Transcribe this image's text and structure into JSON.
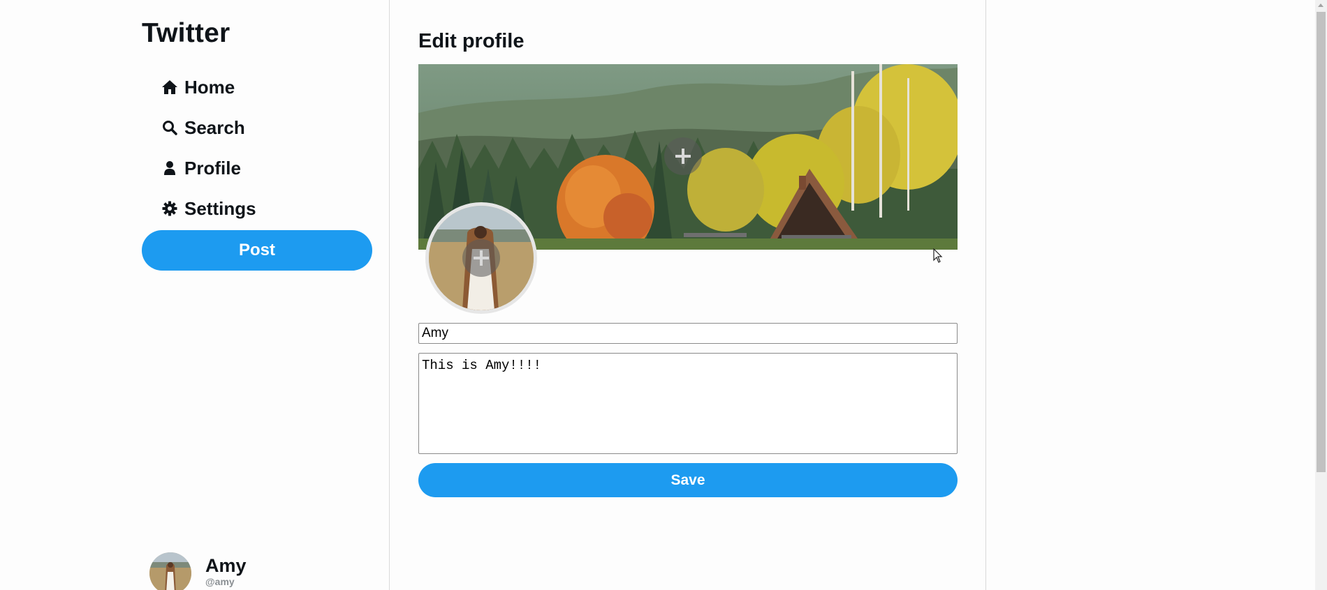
{
  "app": {
    "logo_text": "Twitter"
  },
  "sidebar": {
    "items": [
      {
        "label": "Home",
        "icon": "home-icon"
      },
      {
        "label": "Search",
        "icon": "search-icon"
      },
      {
        "label": "Profile",
        "icon": "user-icon"
      },
      {
        "label": "Settings",
        "icon": "gear-icon"
      }
    ],
    "post_label": "Post"
  },
  "account": {
    "name": "Amy",
    "handle": "@amy"
  },
  "edit_profile": {
    "title": "Edit profile",
    "banner_image": "autumn-forest-cabin-landscape",
    "avatar_image": "woman-in-field-photo",
    "name_value": "Amy",
    "bio_value": "This is Amy!!!!",
    "save_label": "Save"
  },
  "colors": {
    "accent": "#1d9bf0",
    "text": "#0f1419",
    "muted": "#8a8f93",
    "divider": "#d9d9d9"
  }
}
